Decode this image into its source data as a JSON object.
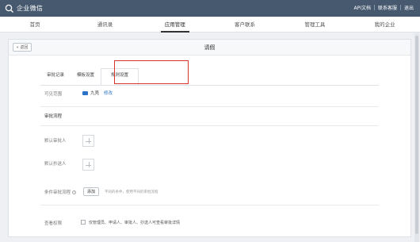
{
  "topbar": {
    "logo_text": "企业微信",
    "links": [
      "API文档",
      "联系客服",
      "退出"
    ]
  },
  "nav": {
    "items": [
      "首页",
      "通讯录",
      "应用管理",
      "客户联系",
      "管理工具",
      "我的企业"
    ],
    "active_index": 2
  },
  "page": {
    "back_label": "« 返回",
    "title": "请假"
  },
  "tabs": {
    "items": [
      "审批记录",
      "模板设置",
      "规则设置"
    ],
    "active_index": 2
  },
  "form": {
    "range_label": "可见范围",
    "range_value": "九壳",
    "edit_label": "修改",
    "flow_section_title": "审批流程",
    "default_approver_label": "默认审批人",
    "default_cc_label": "默认抄送人",
    "condition_label": "条件审批流程",
    "add_button": "添加",
    "condition_note": "不同的条件，使用不同的审批流程",
    "view_permission_label": "查看权限",
    "view_permission_option": "仅管理员、申请人、审批人、抄送人可查看审批详情"
  },
  "colors": {
    "topbar": "#46596f",
    "highlight": "#d9342b",
    "link": "#2b74c7"
  }
}
